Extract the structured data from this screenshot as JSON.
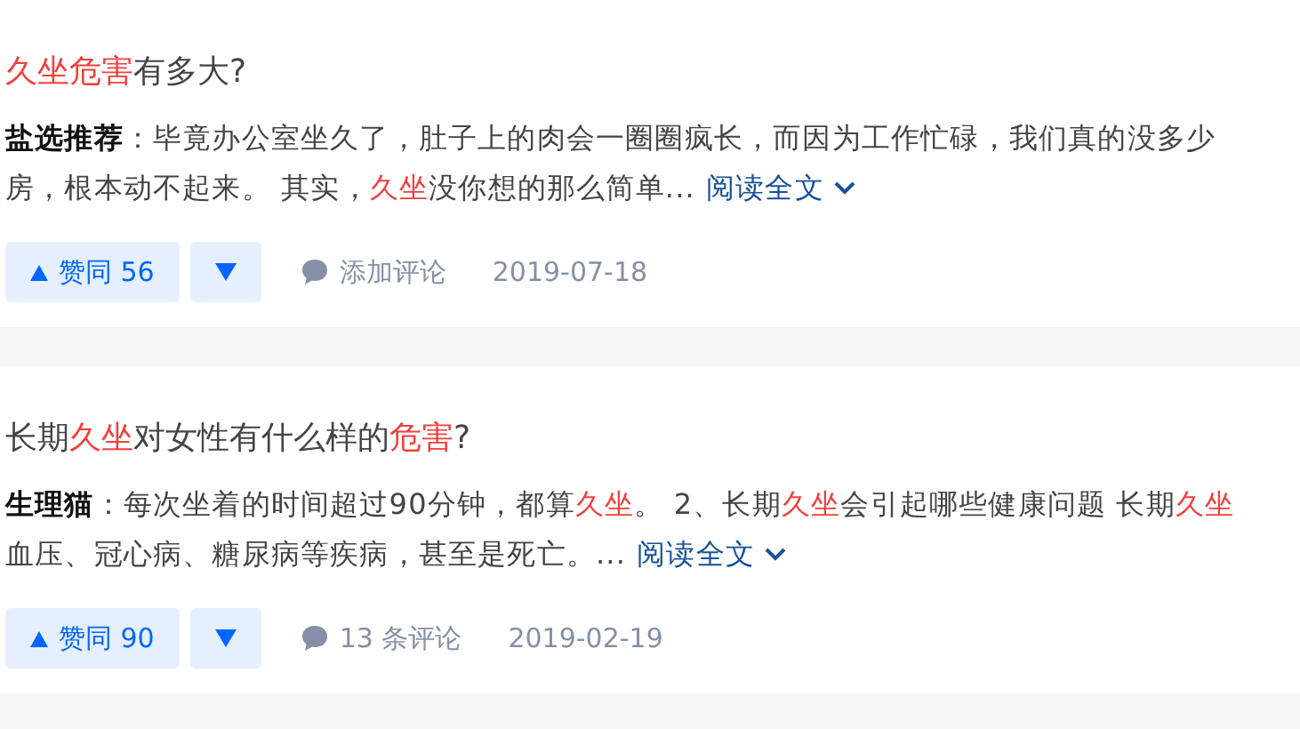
{
  "results": [
    {
      "title": [
        {
          "text": "久坐危害",
          "kind": "highlight"
        },
        {
          "text": "有多大?",
          "kind": "plain"
        }
      ],
      "excerpt_lines": [
        [
          {
            "text": "盐选推荐",
            "kind": "author"
          },
          {
            "text": "：毕竟办公室坐久了，肚子上的肉会一圈圈疯长，而因为工作忙碌，我们真的没多少",
            "kind": "plain"
          }
        ],
        [
          {
            "text": "房，根本动不起来。 其实，",
            "kind": "plain"
          },
          {
            "text": "久坐",
            "kind": "highlight"
          },
          {
            "text": "没你想的那么简单...",
            "kind": "plain"
          }
        ]
      ],
      "read_more": "阅读全文",
      "vote_up": "赞同 56",
      "comment": "添加评论",
      "date": "2019-07-18"
    },
    {
      "title": [
        {
          "text": "长期",
          "kind": "plain"
        },
        {
          "text": "久坐",
          "kind": "highlight"
        },
        {
          "text": "对女性有什么样的",
          "kind": "plain"
        },
        {
          "text": "危害",
          "kind": "highlight"
        },
        {
          "text": "?",
          "kind": "plain"
        }
      ],
      "excerpt_lines": [
        [
          {
            "text": "生理猫",
            "kind": "author"
          },
          {
            "text": "：每次坐着的时间超过90分钟，都算",
            "kind": "plain"
          },
          {
            "text": "久坐",
            "kind": "highlight"
          },
          {
            "text": "。 2、长期",
            "kind": "plain"
          },
          {
            "text": "久坐",
            "kind": "highlight"
          },
          {
            "text": "会引起哪些健康问题 长期",
            "kind": "plain"
          },
          {
            "text": "久坐",
            "kind": "highlight"
          }
        ],
        [
          {
            "text": "血压、冠心病、糖尿病等疾病，甚至是死亡。...",
            "kind": "plain"
          }
        ]
      ],
      "read_more": "阅读全文",
      "vote_up": "赞同 90",
      "comment": "13 条评论",
      "date": "2019-02-19"
    }
  ]
}
